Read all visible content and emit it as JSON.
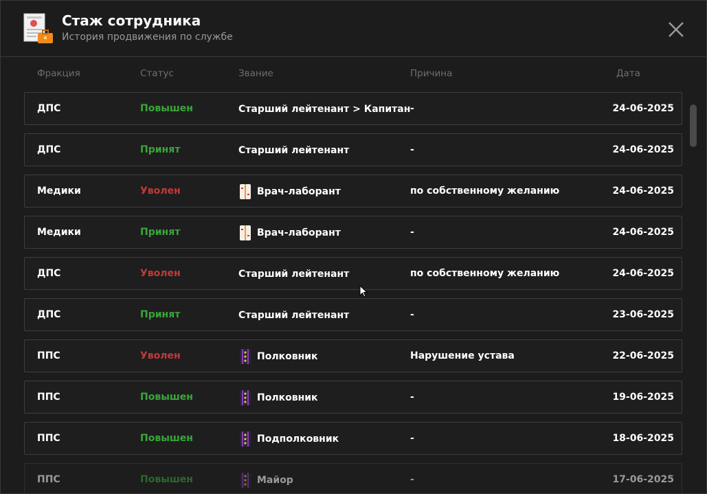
{
  "header": {
    "title": "Стаж сотрудника",
    "subtitle": "История продвижения по службе",
    "icon": "document-briefcase-icon",
    "close_icon": "close-icon"
  },
  "columns": {
    "faction": "Фракция",
    "status": "Статус",
    "rank": "Звание",
    "reason": "Причина",
    "date": "Дата"
  },
  "colors": {
    "promoted": "#3aa63a",
    "hired": "#3aa63a",
    "fired": "#c23a3a",
    "background": "#1c1c1c",
    "row_border": "#3e3e3e"
  },
  "rows": [
    {
      "faction": "ДПС",
      "status": "Повышен",
      "status_type": "up",
      "rank": "Старший лейтенант > Капитан",
      "rank_icon": "",
      "reason": "-",
      "date": "24-06-2025"
    },
    {
      "faction": "ДПС",
      "status": "Принят",
      "status_type": "in",
      "rank": "Старший лейтенант",
      "rank_icon": "",
      "reason": "-",
      "date": "24-06-2025"
    },
    {
      "faction": "Медики",
      "status": "Уволен",
      "status_type": "out",
      "rank": "Врач-лаборант",
      "rank_icon": "medic-rank-icon",
      "reason": "по собственному желанию",
      "date": "24-06-2025"
    },
    {
      "faction": "Медики",
      "status": "Принят",
      "status_type": "in",
      "rank": "Врач-лаборант",
      "rank_icon": "medic-rank-icon",
      "reason": "-",
      "date": "24-06-2025"
    },
    {
      "faction": "ДПС",
      "status": "Уволен",
      "status_type": "out",
      "rank": "Старший лейтенант",
      "rank_icon": "",
      "reason": "по собственному желанию",
      "date": "24-06-2025"
    },
    {
      "faction": "ДПС",
      "status": "Принят",
      "status_type": "in",
      "rank": "Старший лейтенант",
      "rank_icon": "",
      "reason": "-",
      "date": "23-06-2025"
    },
    {
      "faction": "ППС",
      "status": "Уволен",
      "status_type": "out",
      "rank": "Полковник",
      "rank_icon": "police-rank-icon",
      "reason": "Нарушение устава",
      "date": "22-06-2025"
    },
    {
      "faction": "ППС",
      "status": "Повышен",
      "status_type": "up",
      "rank": "Полковник",
      "rank_icon": "police-rank-icon",
      "reason": "-",
      "date": "19-06-2025"
    },
    {
      "faction": "ППС",
      "status": "Повышен",
      "status_type": "up",
      "rank": "Подполковник",
      "rank_icon": "police-rank-icon",
      "reason": "-",
      "date": "18-06-2025"
    },
    {
      "faction": "ППС",
      "status": "Повышен",
      "status_type": "up",
      "rank": "Майор",
      "rank_icon": "police-rank-icon",
      "reason": "-",
      "date": "17-06-2025"
    }
  ]
}
